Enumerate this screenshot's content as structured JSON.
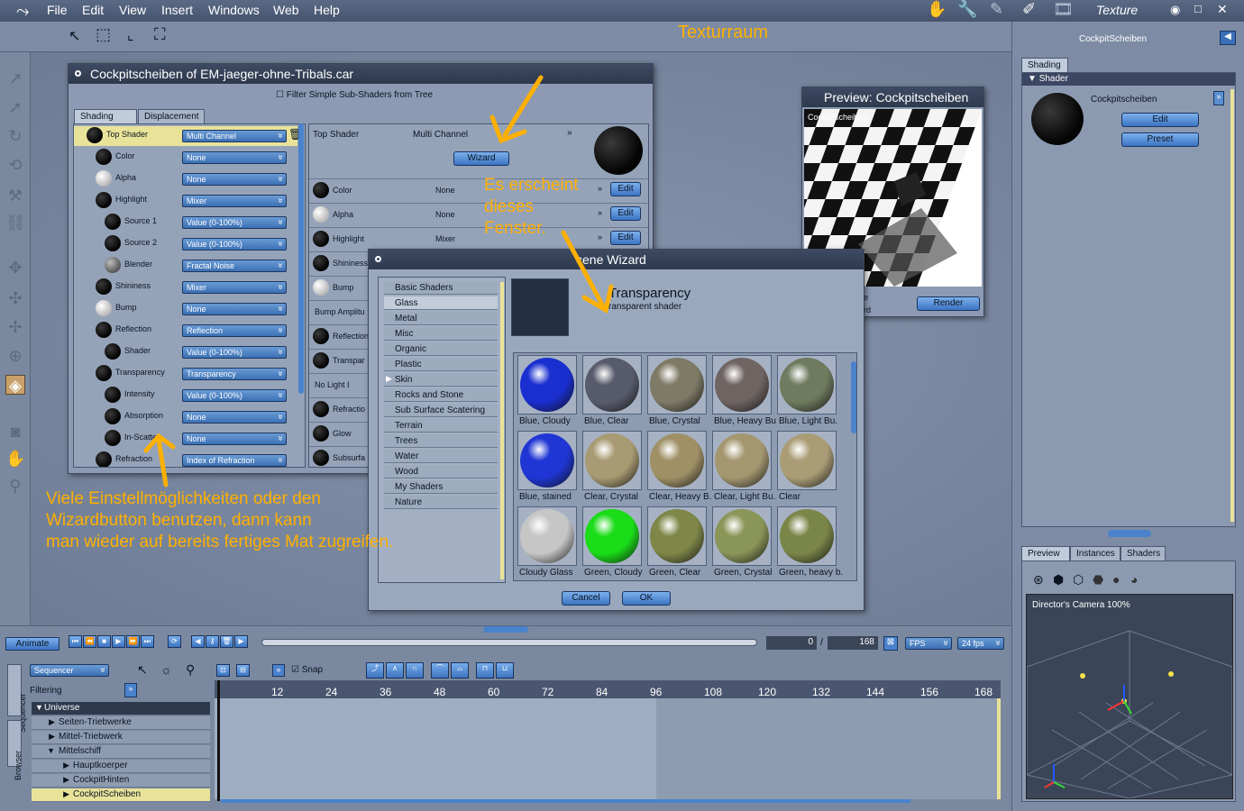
{
  "menubar": {
    "items": [
      "File",
      "Edit",
      "View",
      "Insert",
      "Windows",
      "Web",
      "Help"
    ],
    "room": "Texture"
  },
  "annotations": {
    "title": "Texturraum",
    "popup_note_1": "Es erscheint",
    "popup_note_2": "dieses",
    "popup_note_3": "Fenster.",
    "bottom_note_1": "Viele Einstellmöglichkeiten oder den",
    "bottom_note_2": "Wizardbutton benutzen, dann kann",
    "bottom_note_3": "man wieder auf bereits fertiges Mat zugreifen."
  },
  "shader_window": {
    "title": "Cockpitscheiben of EM-jaeger-ohne-Tribals.car",
    "filter_label": "Filter Simple Sub-Shaders from Tree",
    "tabs": [
      "Shading",
      "Displacement"
    ],
    "tree": [
      {
        "label": "Top Shader",
        "value": "Multi Channel"
      },
      {
        "label": "Color",
        "value": "None"
      },
      {
        "label": "Alpha",
        "value": "None"
      },
      {
        "label": "Highlight",
        "value": "Mixer"
      },
      {
        "label": "Source 1",
        "value": "Value (0-100%)"
      },
      {
        "label": "Source 2",
        "value": "Value (0-100%)"
      },
      {
        "label": "Blender",
        "value": "Fractal Noise"
      },
      {
        "label": "Shininess",
        "value": "Mixer"
      },
      {
        "label": "Bump",
        "value": "None"
      },
      {
        "label": "Reflection",
        "value": "Reflection"
      },
      {
        "label": "Shader",
        "value": "Value (0-100%)"
      },
      {
        "label": "Transparency",
        "value": "Transparency"
      },
      {
        "label": "Intensity",
        "value": "Value (0-100%)"
      },
      {
        "label": "Absorption",
        "value": "None"
      },
      {
        "label": "In-Scatte",
        "value": "None"
      },
      {
        "label": "Refraction",
        "value": "Index of Refraction"
      }
    ],
    "detail_top_label": "Top Shader",
    "detail_top_value": "Multi Channel",
    "wizard_label": "Wizard",
    "detail_rows": [
      {
        "label": "Color",
        "value": "None",
        "btn": "Edit"
      },
      {
        "label": "Alpha",
        "value": "None",
        "btn": "Edit"
      },
      {
        "label": "Highlight",
        "value": "Mixer",
        "btn": "Edit"
      },
      {
        "label": "Shininess",
        "value": ""
      },
      {
        "label": "Bump",
        "value": ""
      },
      {
        "label": "Bump Amplitu",
        "value": ""
      },
      {
        "label": "Reflection",
        "value": ""
      },
      {
        "label": "Transpar",
        "value": ""
      },
      {
        "label": "No Light I",
        "value": ""
      },
      {
        "label": "Refractio",
        "value": ""
      },
      {
        "label": "Glow",
        "value": ""
      },
      {
        "label": "Subsurfa",
        "value": ""
      }
    ]
  },
  "preview_window": {
    "title": "Preview: Cockpitscheiben",
    "overlay": "Cockpitscheiben",
    "frag1": "e",
    "frag2": "rd",
    "render_label": "Render"
  },
  "wizard": {
    "title": "cene Wizard",
    "categories": [
      "Basic Shaders",
      "Glass",
      "Metal",
      "Misc",
      "Organic",
      "Plastic",
      "Skin",
      "Rocks and Stone",
      "Sub Surface Scatering",
      "Terrain",
      "Trees",
      "Water",
      "Wood",
      "My Shaders",
      "Nature"
    ],
    "selected": "Glass",
    "heading": "Transparency",
    "subheading": "ransparent shader",
    "materials": [
      {
        "label": "Blue, Cloudy",
        "color": "#1a2fd0"
      },
      {
        "label": "Blue, Clear",
        "color": "#585b6c"
      },
      {
        "label": "Blue, Crystal",
        "color": "#7e7a66"
      },
      {
        "label": "Blue, Heavy Bu",
        "color": "#6e6462"
      },
      {
        "label": "Blue, Light Bu.",
        "color": "#6f7a5e"
      },
      {
        "label": "Blue, stained",
        "color": "#1f36d4"
      },
      {
        "label": "Clear, Crystal",
        "color": "#a89a72"
      },
      {
        "label": "Clear, Heavy B.",
        "color": "#9f9066"
      },
      {
        "label": "Clear, Light Bu.",
        "color": "#a49770"
      },
      {
        "label": "Clear",
        "color": "#aa9d76"
      },
      {
        "label": "Cloudy Glass",
        "color": "#c6c6c6"
      },
      {
        "label": "Green, Cloudy",
        "color": "#1adc18"
      },
      {
        "label": "Green, Clear",
        "color": "#7e8648"
      },
      {
        "label": "Green, Crystal",
        "color": "#8a9558"
      },
      {
        "label": "Green, heavy b.",
        "color": "#7a8548"
      }
    ],
    "cancel": "Cancel",
    "ok": "OK"
  },
  "right_panel": {
    "title": "CockpitScheiben",
    "tab": "Shading",
    "section": "Shader",
    "shader_name": "Cockpitscheiben",
    "edit": "Edit",
    "preset": "Preset",
    "bottom_tabs": [
      "Preview",
      "Instances",
      "Shaders"
    ],
    "camera": "Director's Camera 100%"
  },
  "timeline": {
    "animate": "Animate",
    "frame": "0",
    "sep": "/",
    "total": "168",
    "fps_mode": "FPS",
    "fps": "24 fps",
    "mode": "Sequencer",
    "snap": "Snap",
    "filtering": "Filtering",
    "side_tabs": [
      "Sequencer",
      "Browser"
    ],
    "ticks": [
      "12",
      "24",
      "36",
      "48",
      "60",
      "72",
      "84",
      "96",
      "108",
      "120",
      "132",
      "144",
      "156",
      "168"
    ],
    "tree": [
      {
        "label": "Universe",
        "indent": 0
      },
      {
        "label": "Seiten-Triebwerke",
        "indent": 1
      },
      {
        "label": "Mittel-Triebwerk",
        "indent": 1
      },
      {
        "label": "Mittelschiff",
        "indent": 1
      },
      {
        "label": "Hauptkoerper",
        "indent": 2
      },
      {
        "label": "CockpitHinten",
        "indent": 2
      },
      {
        "label": "CockpitScheiben",
        "indent": 2
      }
    ]
  },
  "colors": {
    "accent": "#ffb000",
    "button": "#4a82cc",
    "titlebar": "#2e394d"
  }
}
